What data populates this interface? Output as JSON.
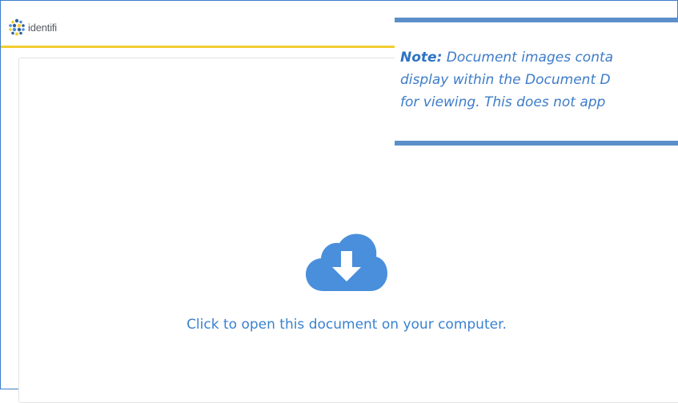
{
  "header": {
    "logo_text": "identifi",
    "logo_icon": "identifi-logo-icon",
    "accent_color": "#f2cd2e"
  },
  "viewer": {
    "icon": "cloud-download-icon",
    "icon_color": "#4a8fdc",
    "open_text": "Click to open this document on your computer."
  },
  "note": {
    "label": "Note:",
    "line1_rest": " Document images conta",
    "line2": "display within the Document D",
    "line3": "for viewing. This does not app",
    "border_color": "#5b8fc9"
  }
}
